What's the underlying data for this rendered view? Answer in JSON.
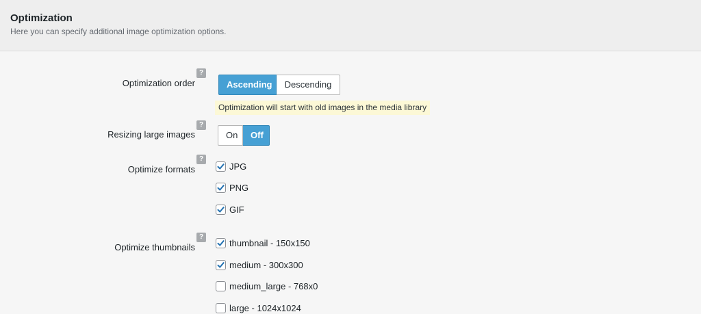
{
  "header": {
    "title": "Optimization",
    "description": "Here you can specify additional image optimization options."
  },
  "help_glyph": "?",
  "optimization_order": {
    "label": "Optimization order",
    "options": [
      "Ascending",
      "Descending"
    ],
    "selected": "Ascending",
    "hint": "Optimization will start with old images in the media library"
  },
  "resizing": {
    "label": "Resizing large images",
    "options": [
      "On",
      "Off"
    ],
    "selected": "Off"
  },
  "formats": {
    "label": "Optimize formats",
    "items": [
      {
        "label": "JPG",
        "checked": true
      },
      {
        "label": "PNG",
        "checked": true
      },
      {
        "label": "GIF",
        "checked": true
      }
    ]
  },
  "thumbnails": {
    "label": "Optimize thumbnails",
    "items": [
      {
        "label": "thumbnail - 150x150",
        "checked": true
      },
      {
        "label": "medium - 300x300",
        "checked": true
      },
      {
        "label": "medium_large - 768x0",
        "checked": false
      },
      {
        "label": "large - 1024x1024",
        "checked": false
      }
    ]
  },
  "colors": {
    "accent": "#46a0d4",
    "checkmark": "#2271b1",
    "hint_bg": "#fcf8d6"
  }
}
